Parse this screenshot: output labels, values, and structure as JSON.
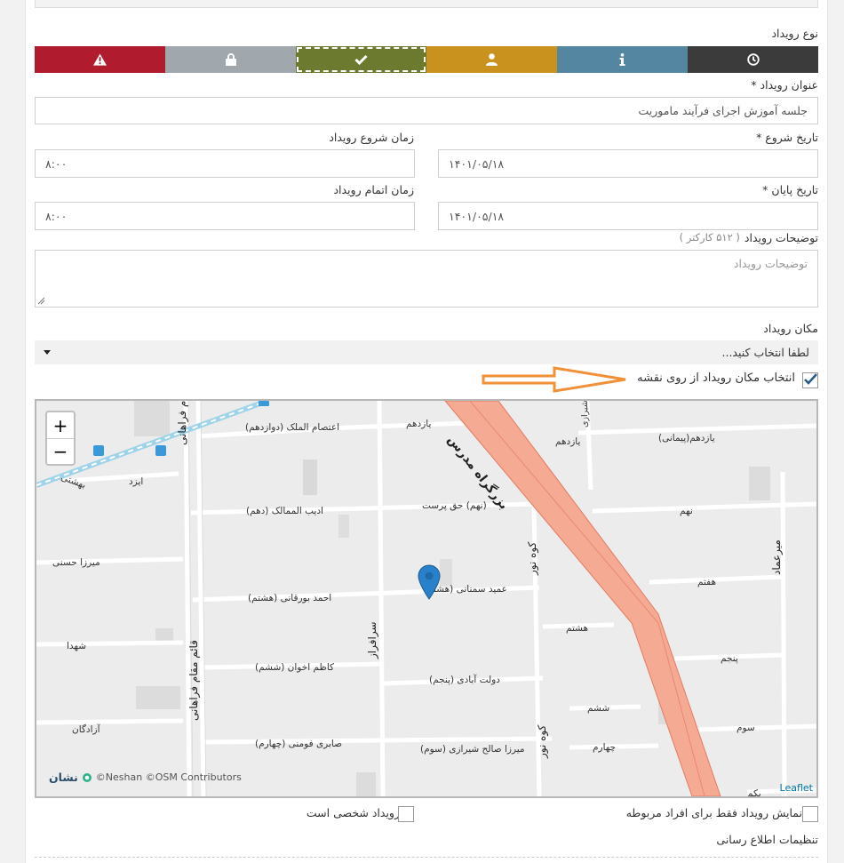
{
  "form": {
    "event_type_label": "نوع رویداد",
    "event_types": [
      {
        "name": "danger",
        "icon": "warning-icon",
        "color": "#b01b2e"
      },
      {
        "name": "private",
        "icon": "lock-icon",
        "color": "#a0a8ad"
      },
      {
        "name": "done",
        "icon": "check-icon",
        "color": "#6b7a2f",
        "selected": true
      },
      {
        "name": "person",
        "icon": "user-icon",
        "color": "#c9921e"
      },
      {
        "name": "info",
        "icon": "info-icon",
        "color": "#5486a1"
      },
      {
        "name": "time",
        "icon": "clock-icon",
        "color": "#3b3b3b"
      }
    ],
    "title_label": "عنوان رویداد *",
    "title_value": "جلسه آموزش اجرای فرآیند ماموریت",
    "start_date_label": "تاریخ شروع *",
    "start_date_value": "۱۴۰۱/۰۵/۱۸",
    "start_time_label": "زمان شروع رویداد",
    "start_time_value": "۸:۰۰",
    "end_date_label": "تاریخ پایان *",
    "end_date_value": "۱۴۰۱/۰۵/۱۸",
    "end_time_label": "زمان اتمام رویداد",
    "end_time_value": "۸:۰۰",
    "description_label": "توضیحات رویداد",
    "description_hint": "( ۵۱۲ کارکتر )",
    "description_placeholder": "توضیحات رویداد",
    "location_label": "مکان رویداد",
    "location_select_value": "لطفا انتخاب کنید...",
    "map_select_label": "انتخاب مکان رویداد از روی نقشه",
    "map_select_checked": true,
    "show_related_only_label": "نمایش رویداد فقط برای افراد مربوطه",
    "personal_event_label": "رویداد شخصی است",
    "notification_settings_label": "تنظیمات اطلاع رسانی"
  },
  "map": {
    "zoom_in": "+",
    "zoom_out": "−",
    "attribution": "©Neshan ©OSM Contributors",
    "brand": "نشان",
    "leaflet": "Leaflet",
    "streets": {
      "s1": "اعتصام الملک (دوازدهم)",
      "s2": "یازدهم",
      "s3": "یازدهم",
      "s4": "یازدهم(پیمانی)",
      "s5": "بزرگراه مدرس",
      "s6": "ایزد",
      "s7": "ادیب الممالک (دهم)",
      "s8": "(نهم) حق پرست",
      "s9": "نهم",
      "s10": "میرزا حسنی",
      "s11": "احمد بورقانی (هشتم)",
      "s12": "عمید سمنانی (هشتم)",
      "s13": "هشتم",
      "s14": "هفتم",
      "s15": "شهدا",
      "s16": "کاظم اخوان (ششم)",
      "s17": "دولت آبادی (پنجم)",
      "s18": "پنجم",
      "s19": "ششم",
      "s20": "آزادگان",
      "s21": "صابری فومنی (چهارم)",
      "s22": "میرزا صالح شیرازی (سوم)",
      "s23": "چهارم",
      "s24": "سوم",
      "s25": "قائم مقام فراهانی",
      "s26": "قائم مقام فراهانی",
      "s27": "سرافراز",
      "s28": "کوه نور",
      "s29": "کوه نور",
      "s30": "میرعماد",
      "s31": "بهشتی",
      "s32": "شیرازی",
      "s33": "بکم"
    }
  }
}
